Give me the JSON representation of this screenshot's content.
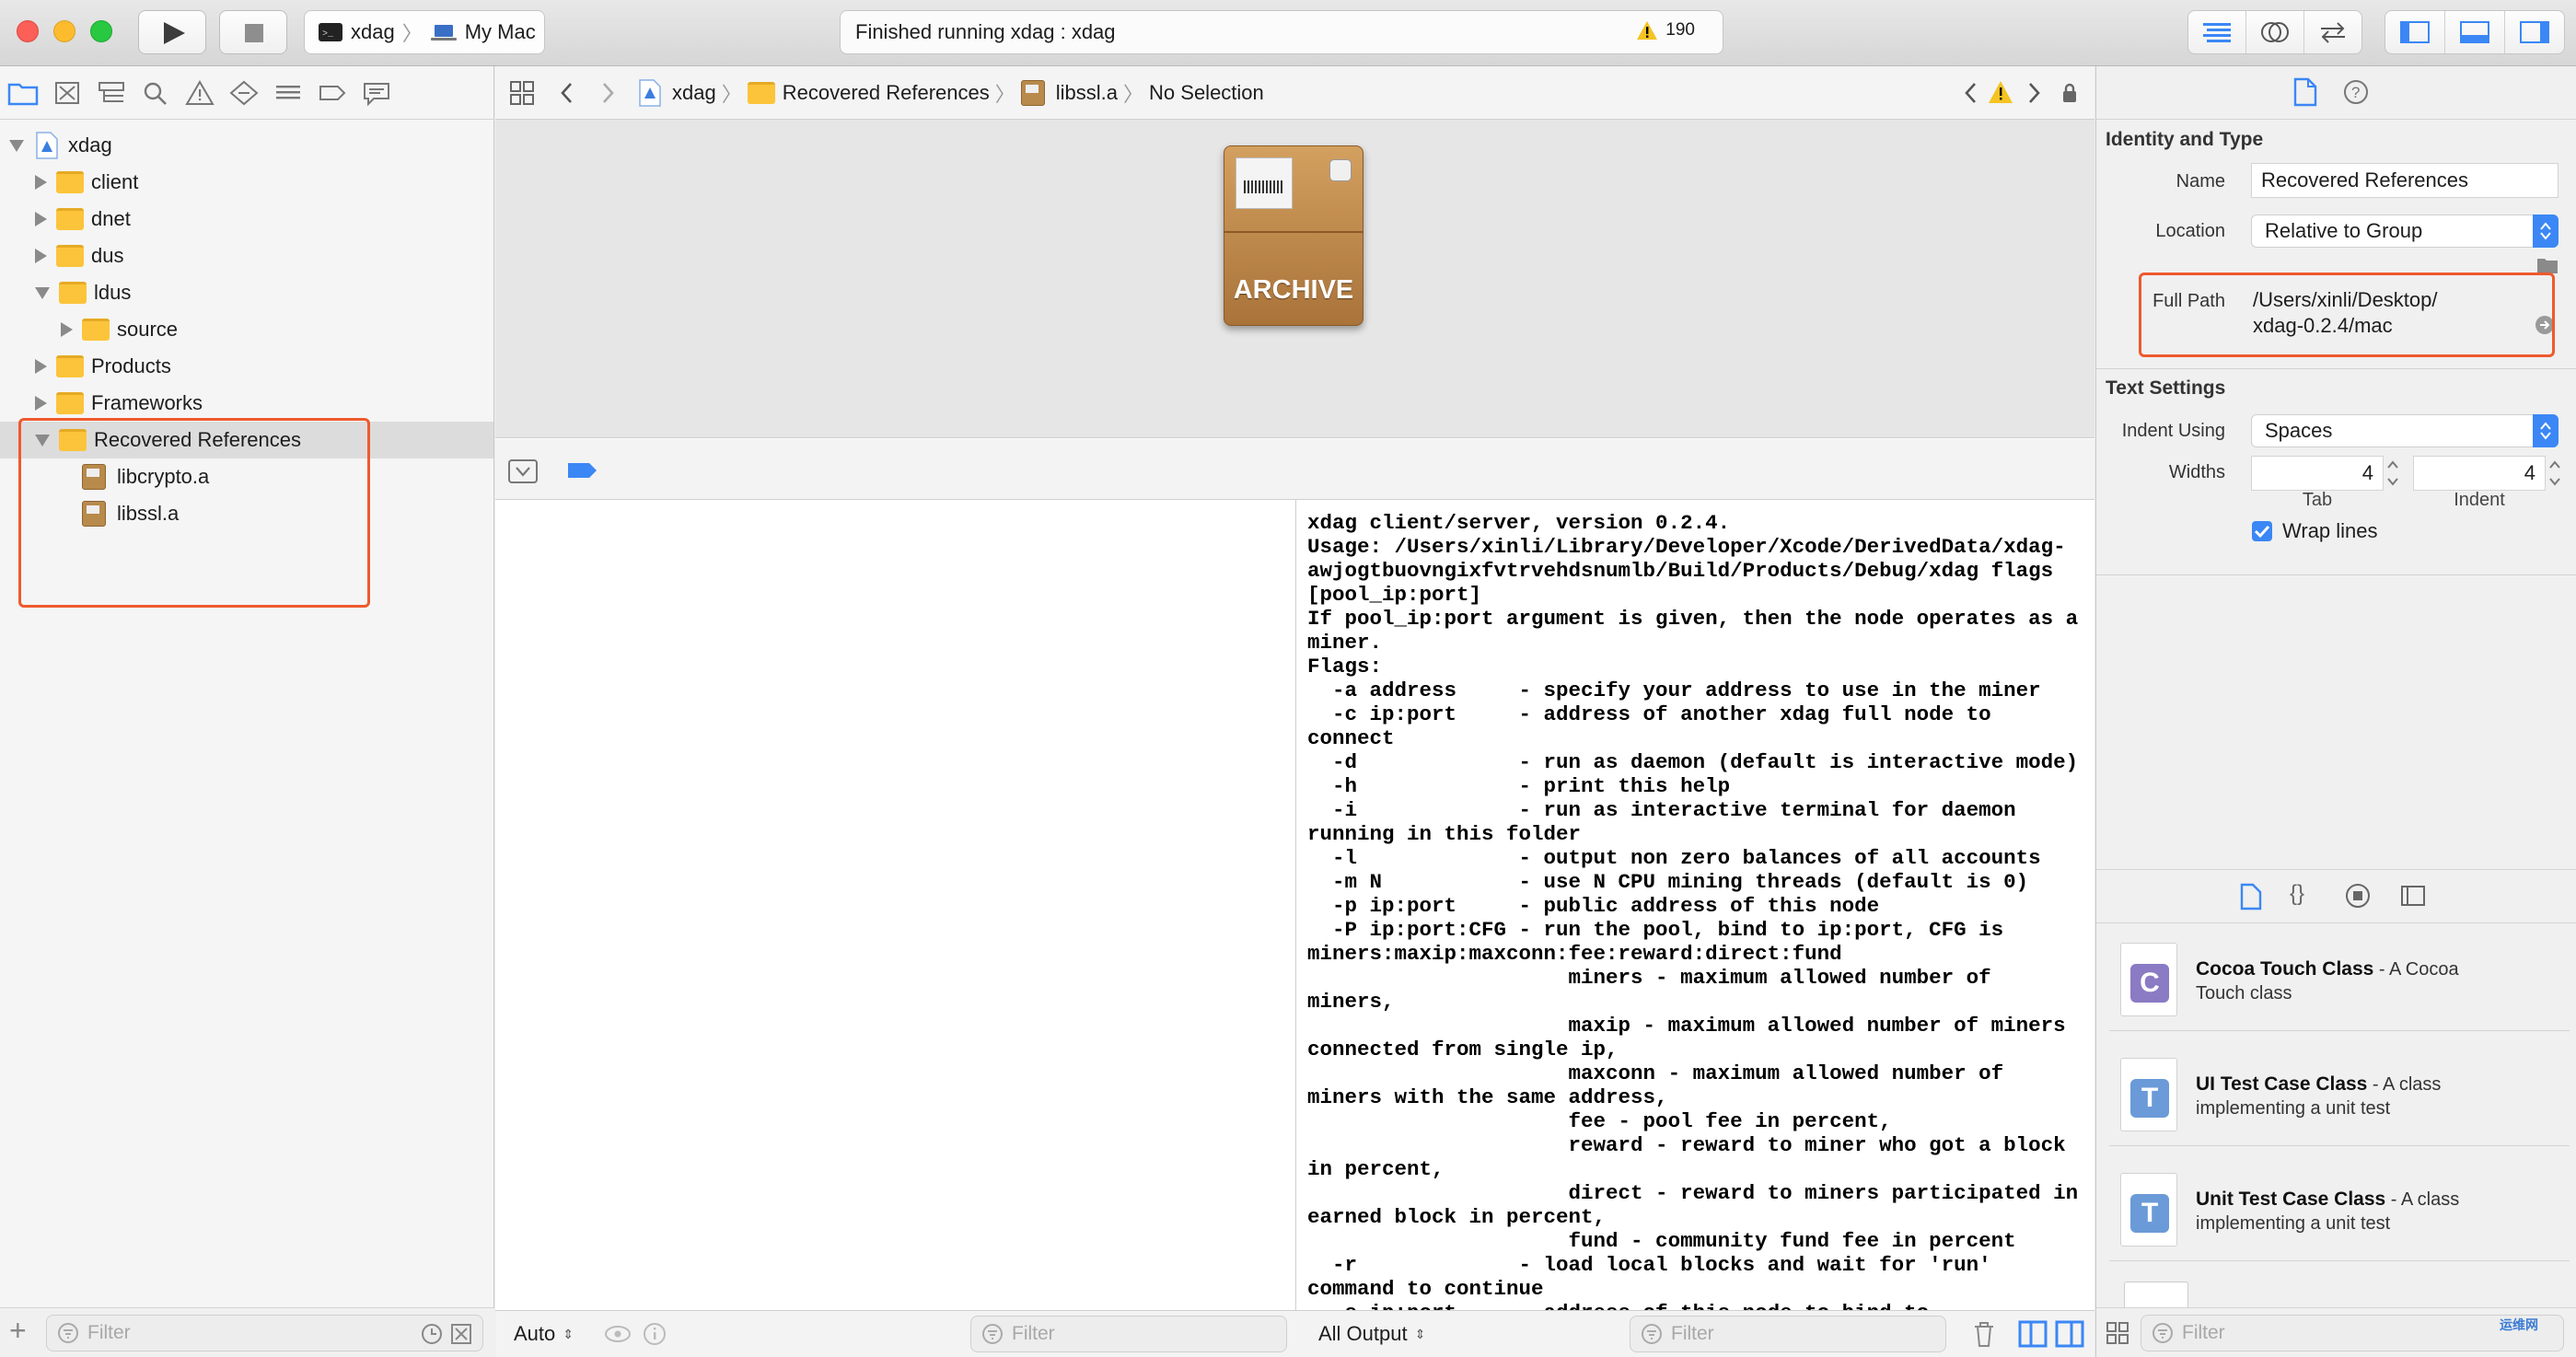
{
  "toolbar": {
    "scheme_name": "xdag",
    "destination": "My Mac",
    "status_text": "Finished running xdag : xdag",
    "warning_count": "190"
  },
  "navigator": {
    "tree": [
      {
        "label": "xdag",
        "depth": 0,
        "kind": "project",
        "expanded": true
      },
      {
        "label": "client",
        "depth": 1,
        "kind": "folder",
        "expanded": false
      },
      {
        "label": "dnet",
        "depth": 1,
        "kind": "folder",
        "expanded": false
      },
      {
        "label": "dus",
        "depth": 1,
        "kind": "folder",
        "expanded": false
      },
      {
        "label": "ldus",
        "depth": 1,
        "kind": "folder",
        "expanded": true
      },
      {
        "label": "source",
        "depth": 2,
        "kind": "folder",
        "expanded": false
      },
      {
        "label": "Products",
        "depth": 1,
        "kind": "folder",
        "expanded": false
      },
      {
        "label": "Frameworks",
        "depth": 1,
        "kind": "folder",
        "expanded": false
      },
      {
        "label": "Recovered References",
        "depth": 1,
        "kind": "folder",
        "expanded": true,
        "selected": true
      },
      {
        "label": "libcrypto.a",
        "depth": 2,
        "kind": "archive"
      },
      {
        "label": "libssl.a",
        "depth": 2,
        "kind": "archive"
      }
    ],
    "filter_placeholder": "Filter"
  },
  "jumpbar": {
    "crumbs": [
      "xdag",
      "Recovered References",
      "libssl.a",
      "No Selection"
    ]
  },
  "editor": {
    "archive_label": "ARCHIVE"
  },
  "debug": {
    "auto_label": "Auto",
    "all_output_label": "All Output",
    "filter_placeholder": "Filter",
    "console_text": "xdag client/server, version 0.2.4.\nUsage: /Users/xinli/Library/Developer/Xcode/DerivedData/xdag-\nawjogtbuovngixfvtrvehdsnumlb/Build/Products/Debug/xdag flags\n[pool_ip:port]\nIf pool_ip:port argument is given, then the node operates as a\nminer.\nFlags:\n  -a address     - specify your address to use in the miner\n  -c ip:port     - address of another xdag full node to\nconnect\n  -d             - run as daemon (default is interactive mode)\n  -h             - print this help\n  -i             - run as interactive terminal for daemon\nrunning in this folder\n  -l             - output non zero balances of all accounts\n  -m N           - use N CPU mining threads (default is 0)\n  -p ip:port     - public address of this node\n  -P ip:port:CFG - run the pool, bind to ip:port, CFG is\nminers:maxip:maxconn:fee:reward:direct:fund\n                     miners - maximum allowed number of\nminers,\n                     maxip - maximum allowed number of miners\nconnected from single ip,\n                     maxconn - maximum allowed number of\nminers with the same address,\n                     fee - pool fee in percent,\n                     reward - reward to miner who got a block\nin percent,\n                     direct - reward to miners participated in\nearned block in percent,\n                     fund - community fund fee in percent\n  -r             - load local blocks and wait for 'run'\ncommand to continue\n  -s ip:port     - address of this node to bind to\n  -t             - connect to test net (default is main net)\n  -v N           - set loglevel to N"
  },
  "inspector": {
    "identity_title": "Identity and Type",
    "name_label": "Name",
    "name_value": "Recovered References",
    "location_label": "Location",
    "location_value": "Relative to Group",
    "fullpath_label": "Full Path",
    "fullpath_line1": "/Users/xinli/Desktop/",
    "fullpath_line2": "xdag-0.2.4/mac",
    "text_settings_title": "Text Settings",
    "indent_using_label": "Indent Using",
    "indent_using_value": "Spaces",
    "widths_label": "Widths",
    "tab_value": "4",
    "indent_value": "4",
    "tab_label": "Tab",
    "indent_label": "Indent",
    "wrap_label": "Wrap lines"
  },
  "library": {
    "items": [
      {
        "title": "Cocoa Touch Class",
        "desc1": " - A Cocoa",
        "desc2": "Touch class",
        "glyph": "C",
        "color": "#8a7bc4"
      },
      {
        "title": "UI Test Case Class",
        "desc1": " - A class",
        "desc2": "implementing a unit test",
        "glyph": "T",
        "color": "#6b9ad8"
      },
      {
        "title": "Unit Test Case Class",
        "desc1": " - A class",
        "desc2": "implementing a unit test",
        "glyph": "T",
        "color": "#6b9ad8"
      }
    ],
    "filter_placeholder": "Filter"
  },
  "watermark": "运维网"
}
